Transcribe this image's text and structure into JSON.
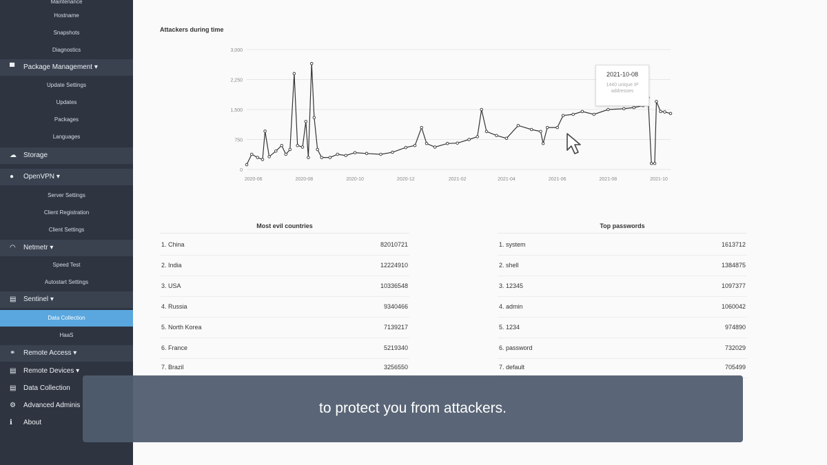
{
  "sidebar": {
    "top_partial": "Maintenance",
    "hostname": "Hostname",
    "snapshots": "Snapshots",
    "diagnostics": "Diagnostics",
    "package_management": {
      "label": "Package Management",
      "caret": "▾",
      "icon": "package-icon"
    },
    "update_settings": "Update Settings",
    "updates": "Updates",
    "packages": "Packages",
    "languages": "Languages",
    "storage": {
      "label": "Storage",
      "icon": "storage-icon"
    },
    "openvpn": {
      "label": "OpenVPN",
      "caret": "▾",
      "icon": "user-icon"
    },
    "server_settings": "Server Settings",
    "client_registration": "Client Registration",
    "client_settings": "Client Settings",
    "netmetr": {
      "label": "Netmetr",
      "caret": "▾",
      "icon": "wifi-icon"
    },
    "speed_test": "Speed Test",
    "autostart_settings": "Autostart Settings",
    "sentinel": {
      "label": "Sentinel",
      "caret": "▾",
      "icon": "database-icon"
    },
    "data_collection_sub": "Data Collection",
    "haas": "HaaS",
    "remote_access": {
      "label": "Remote Access",
      "caret": "▾",
      "icon": "link-icon"
    },
    "remote_devices": {
      "label": "Remote Devices",
      "caret": "▾",
      "icon": "devices-icon"
    },
    "data_collection": {
      "label": "Data Collection",
      "icon": "database-icon"
    },
    "advanced_admin": {
      "label": "Advanced Adminis",
      "icon": "gear-icon"
    },
    "about": {
      "label": "About",
      "icon": "info-icon"
    }
  },
  "chart_title": "Attackers during time",
  "chart_data": {
    "type": "line",
    "title": "Attackers during time",
    "xlabel": "",
    "ylabel": "",
    "ylim": [
      0,
      3000
    ],
    "yticks": [
      "0",
      "750",
      "1,500",
      "2,250",
      "3,000"
    ],
    "xticks": [
      "2020-06",
      "2020-08",
      "2020-10",
      "2020-12",
      "2021-02",
      "2021-04",
      "2021-06",
      "2021-08",
      "2021-10"
    ],
    "x_range": [
      "2020-05-24",
      "2021-10-15"
    ],
    "grid": true,
    "series": [
      {
        "points": [
          [
            "2020-05-24",
            120
          ],
          [
            "2020-05-30",
            380
          ],
          [
            "2020-06-06",
            300
          ],
          [
            "2020-06-12",
            250
          ],
          [
            "2020-06-15",
            960
          ],
          [
            "2020-06-20",
            320
          ],
          [
            "2020-06-28",
            460
          ],
          [
            "2020-07-05",
            600
          ],
          [
            "2020-07-10",
            380
          ],
          [
            "2020-07-15",
            500
          ],
          [
            "2020-07-20",
            2400
          ],
          [
            "2020-07-24",
            600
          ],
          [
            "2020-07-30",
            560
          ],
          [
            "2020-08-03",
            1200
          ],
          [
            "2020-08-06",
            300
          ],
          [
            "2020-08-10",
            2650
          ],
          [
            "2020-08-13",
            1300
          ],
          [
            "2020-08-17",
            500
          ],
          [
            "2020-08-22",
            300
          ],
          [
            "2020-09-01",
            300
          ],
          [
            "2020-09-10",
            380
          ],
          [
            "2020-09-20",
            350
          ],
          [
            "2020-10-01",
            420
          ],
          [
            "2020-10-15",
            400
          ],
          [
            "2020-11-01",
            380
          ],
          [
            "2020-11-15",
            430
          ],
          [
            "2020-12-01",
            550
          ],
          [
            "2020-12-12",
            600
          ],
          [
            "2020-12-20",
            1050
          ],
          [
            "2020-12-26",
            650
          ],
          [
            "2021-01-05",
            560
          ],
          [
            "2021-01-20",
            650
          ],
          [
            "2021-02-01",
            660
          ],
          [
            "2021-02-15",
            750
          ],
          [
            "2021-02-25",
            820
          ],
          [
            "2021-03-02",
            1500
          ],
          [
            "2021-03-08",
            950
          ],
          [
            "2021-03-20",
            850
          ],
          [
            "2021-04-01",
            780
          ],
          [
            "2021-04-15",
            1100
          ],
          [
            "2021-05-01",
            1000
          ],
          [
            "2021-05-12",
            950
          ],
          [
            "2021-05-15",
            650
          ],
          [
            "2021-05-20",
            1050
          ],
          [
            "2021-06-01",
            1050
          ],
          [
            "2021-06-08",
            1350
          ],
          [
            "2021-06-20",
            1380
          ],
          [
            "2021-07-01",
            1450
          ],
          [
            "2021-07-15",
            1380
          ],
          [
            "2021-08-01",
            1500
          ],
          [
            "2021-08-20",
            1520
          ],
          [
            "2021-09-01",
            1550
          ],
          [
            "2021-09-12",
            1600
          ],
          [
            "2021-09-18",
            1800
          ],
          [
            "2021-09-22",
            150
          ],
          [
            "2021-09-26",
            150
          ],
          [
            "2021-09-28",
            1700
          ],
          [
            "2021-10-03",
            1450
          ],
          [
            "2021-10-08",
            1440
          ],
          [
            "2021-10-15",
            1400
          ]
        ]
      }
    ]
  },
  "tooltip": {
    "date": "2021-10-08",
    "text": "1440 unique IP addresses"
  },
  "countries": {
    "title": "Most evil countries",
    "rows": [
      {
        "name": "1. China",
        "value": "82010721"
      },
      {
        "name": "2. India",
        "value": "12224910"
      },
      {
        "name": "3. USA",
        "value": "10336548"
      },
      {
        "name": "4. Russia",
        "value": "9340466"
      },
      {
        "name": "5. North Korea",
        "value": "7139217"
      },
      {
        "name": "6. France",
        "value": "5219340"
      },
      {
        "name": "7. Brazil",
        "value": "3256550"
      }
    ]
  },
  "passwords": {
    "title": "Top passwords",
    "rows": [
      {
        "name": "1. system",
        "value": "1613712"
      },
      {
        "name": "2. shell",
        "value": "1384875"
      },
      {
        "name": "3. 12345",
        "value": "1097377"
      },
      {
        "name": "4. admin",
        "value": "1060042"
      },
      {
        "name": "5. 1234",
        "value": "974890"
      },
      {
        "name": "6. password",
        "value": "732029"
      },
      {
        "name": "7. default",
        "value": "705499"
      }
    ]
  },
  "subtitle": "to protect you from attackers."
}
